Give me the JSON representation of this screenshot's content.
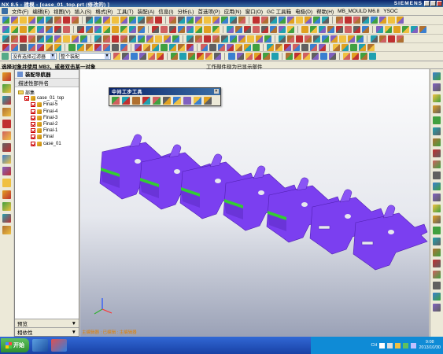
{
  "window": {
    "title": "NX 8.5 - 建模 - [case_01_top.prt (修改的) ]",
    "brand": "SIEMENS"
  },
  "menu": {
    "items": [
      "文件(F)",
      "编辑(E)",
      "视图(V)",
      "插入(S)",
      "格式(R)",
      "工具(T)",
      "装配(A)",
      "信息(I)",
      "分析(L)",
      "首选项(P)",
      "应用(N)",
      "窗口(O)",
      "GC 工具箱",
      "电极(D)",
      "帮助(H)",
      "MB_MOULD M6.8",
      "YSOC"
    ]
  },
  "selection_bar": {
    "filter_value": "没有选择过滤器",
    "assembly_value": "整个装配"
  },
  "status": {
    "prompt": "选择对象并使用 MB3，或者双击某一对象",
    "work_part": "工作部件现为已显示部件"
  },
  "navigator": {
    "title": "装配导航器",
    "column_header": "描述性部件名",
    "tree": [
      {
        "label": "部集",
        "depth": 0,
        "kind": "folder"
      },
      {
        "label": "case_01_top",
        "depth": 1,
        "kind": "assembly"
      },
      {
        "label": "Final-5",
        "depth": 2,
        "kind": "part"
      },
      {
        "label": "Final-4",
        "depth": 2,
        "kind": "part"
      },
      {
        "label": "Final-3",
        "depth": 2,
        "kind": "part"
      },
      {
        "label": "Final-2",
        "depth": 2,
        "kind": "part"
      },
      {
        "label": "Final-1",
        "depth": 2,
        "kind": "part"
      },
      {
        "label": "Final",
        "depth": 2,
        "kind": "part"
      },
      {
        "label": "case_01",
        "depth": 2,
        "kind": "part"
      }
    ],
    "bottom_panels": [
      "预览",
      "相依性"
    ]
  },
  "floating_toolbar": {
    "title": "中间工步工具"
  },
  "viewport": {
    "bottom_label": "主编辑器 : 已编辑 : 主编辑器",
    "part_color": "#7b3ff0",
    "edge_color": "#33cc33",
    "parts_count_visible": 7
  },
  "taskbar": {
    "start_label": "开始",
    "ime": "CH",
    "clock_time": "9:08",
    "clock_date": "2013/10/30"
  }
}
